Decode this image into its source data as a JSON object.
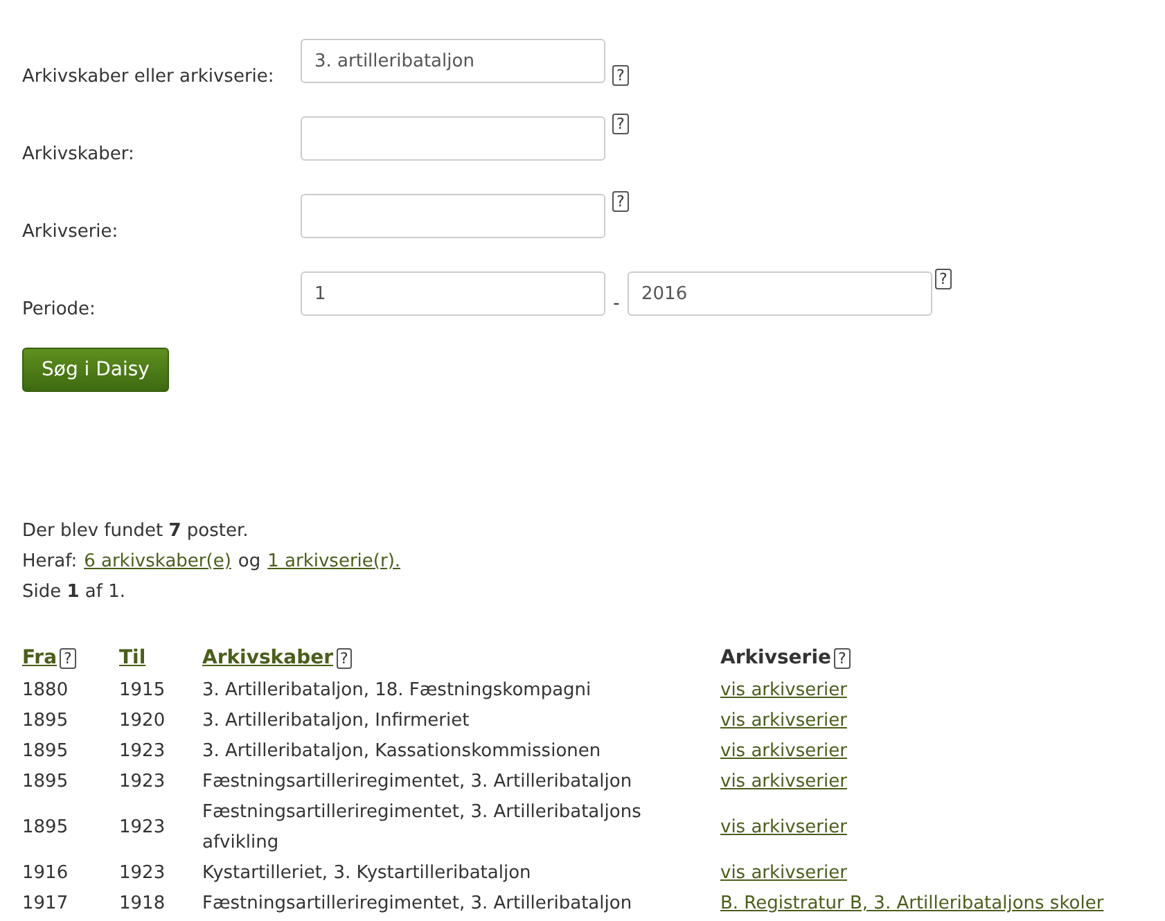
{
  "search_form": {
    "fields": [
      {
        "label": "Arkivskaber eller arkivserie:",
        "value": "3. artilleribataljon",
        "help": "?"
      },
      {
        "label": "Arkivskaber:",
        "help": "?"
      },
      {
        "label": "Arkivserie:",
        "help": "?"
      }
    ],
    "period": {
      "label": "Periode:",
      "from": "1",
      "separator": "-",
      "to": "2016",
      "help": "?"
    },
    "submit": "Søg i Daisy"
  },
  "results_summary": {
    "found": "Der blev fundet **7**  poster.",
    "breakdown_prefix": "Heraf:",
    "links": [
      "6 arkivskaber(e)",
      "1 arkivserie(r)."
    ],
    "joiner": "og",
    "page": "Side **1** af 1."
  },
  "table": {
    "columns": [
      {
        "label": "Fra",
        "link": true,
        "help": "?"
      },
      {
        "label": "Til",
        "link": true
      },
      {
        "label": "Arkivskaber",
        "link": true,
        "help": "?"
      },
      {
        "label": "Arkivserie",
        "link": false,
        "help": "?"
      }
    ],
    "rows": [
      {
        "fra": "1880",
        "til": "1915",
        "arkivskaber": "3. Artilleribataljon, 18. Fæstningskompagni",
        "arkivserie": "vis arkivserier"
      },
      {
        "fra": "1895",
        "til": "1920",
        "arkivskaber": "3. Artilleribataljon, Infirmeriet",
        "arkivserie": "vis arkivserier"
      },
      {
        "fra": "1895",
        "til": "1923",
        "arkivskaber": "3. Artilleribataljon, Kassationskommissionen",
        "arkivserie": "vis arkivserier"
      },
      {
        "fra": "1895",
        "til": "1923",
        "arkivskaber": "Fæstningsartilleriregimentet, 3. Artilleribataljon",
        "arkivserie": "vis arkivserier"
      },
      {
        "fra": "1895",
        "til": "1923",
        "arkivskaber": "Fæstningsartilleriregimentet, 3. Artilleribataljons afvikling",
        "arkivserie": "vis arkivserier"
      },
      {
        "fra": "1916",
        "til": "1923",
        "arkivskaber": "Kystartilleriet, 3. Kystartilleribataljon",
        "arkivserie": "vis arkivserier"
      },
      {
        "fra": "1917",
        "til": "1918",
        "arkivskaber": "Fæstningsartilleriregimentet, 3. Artilleribataljon",
        "arkivserie": "B. Registratur B, 3. Artilleribataljons skoler"
      }
    ]
  }
}
